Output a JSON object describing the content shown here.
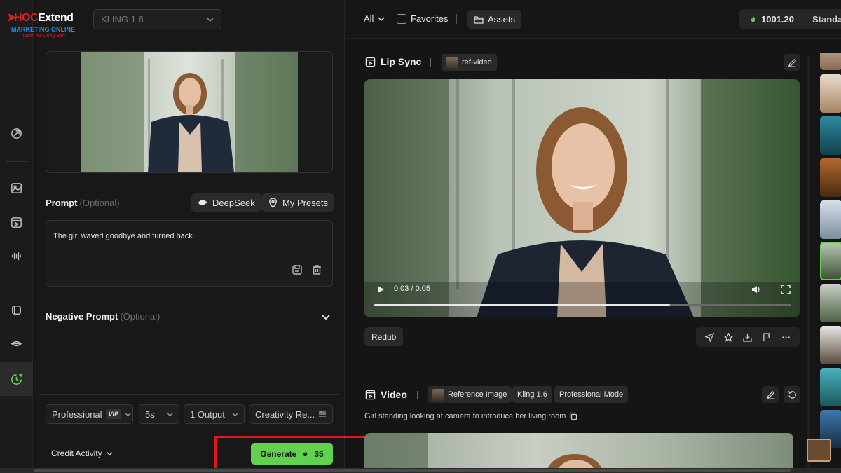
{
  "logo": {
    "brand_prefix": "HOC",
    "brand_suffix": "Extend",
    "subtitle": "MARKETING ONLINE",
    "tagline": "Vươn Xa Cùng Bạn"
  },
  "model": {
    "selected": "KLING 1.6"
  },
  "prompt": {
    "label": "Prompt",
    "optional": "(Optional)",
    "deepseek_label": "DeepSeek",
    "presets_label": "My Presets",
    "value": "The girl waved goodbye and turned back."
  },
  "negative_prompt": {
    "label": "Negative Prompt",
    "optional": "(Optional)"
  },
  "options": {
    "mode": "Professional",
    "vip": "VIP",
    "duration": "5s",
    "outputs": "1 Output",
    "creativity": "Creativity Re..."
  },
  "footer": {
    "credit_activity": "Credit Activity",
    "generate_label": "Generate",
    "generate_cost": "35"
  },
  "topbar": {
    "filter_all": "All",
    "favorites": "Favorites",
    "assets": "Assets",
    "credits": "1001.20",
    "plan": "Standa"
  },
  "lip_sync": {
    "title": "Lip Sync",
    "tag": "ref-video",
    "time": "0:03 / 0:05",
    "progress": 0.71,
    "redub_label": "Redub"
  },
  "video_section": {
    "title": "Video",
    "tags": [
      "Reference Image",
      "Kling 1.6",
      "Professional Mode"
    ],
    "caption": "Girl standing looking at camera to introduce her living room"
  },
  "colors": {
    "accent": "#62d24e",
    "highlight": "#e01a1a",
    "background": "#151515"
  }
}
